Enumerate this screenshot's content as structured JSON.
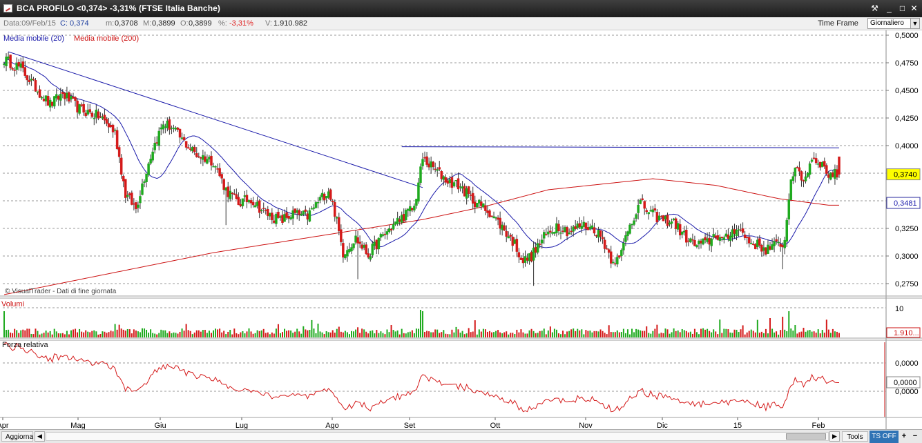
{
  "window": {
    "title": "BCA PROFILO <0,374> -3,31% (FTSE Italia Banche)"
  },
  "infobar": {
    "date": "Data:09/Feb/15",
    "close": "C: 0,374",
    "min_label": "m:",
    "min": "0,3708",
    "max_label": "M:",
    "max": "0,3899",
    "open_label": "O:",
    "open": "0,3899",
    "pct_label": "%:",
    "pct": "-3,31%",
    "vol_label": "V:",
    "vol": "1.910.982",
    "timeframe_label": "Time Frame",
    "timeframe_value": "Giornaliero"
  },
  "price_panel": {
    "legend_ma20": "Media mobile (20)",
    "legend_ma200": "Media mobile (200)",
    "watermark": "© VisualTrader - Dati di fine giornata",
    "y_labels": [
      "0,5000",
      "0,4750",
      "0,4500",
      "0,4250",
      "0,4000",
      "0,3750",
      "0,3500",
      "0,3250",
      "0,3000",
      "0,2750"
    ],
    "last_price_tag": "0,3740",
    "ma_tag": "0,3481"
  },
  "volume_panel": {
    "label": "Volumi",
    "y_label": "10",
    "last_tag": "1.910..."
  },
  "rs_panel": {
    "label": "Forza relativa",
    "y_labels": [
      "0,0000",
      "0,0000"
    ],
    "last_tag": "0,0000"
  },
  "x_labels": [
    "Apr",
    "Mag",
    "Giu",
    "Lug",
    "Ago",
    "Set",
    "Ott",
    "Nov",
    "Dic",
    "15",
    "Feb"
  ],
  "bottombar": {
    "refresh": "Aggiorna",
    "tools": "Tools",
    "tsoff": "TS OFF",
    "plus": "+",
    "minus": "−"
  },
  "colors": {
    "up": "#1faa1f",
    "down": "#d41a1a",
    "ma20": "#1a1aaa",
    "ma200": "#cc1111",
    "trendline": "#1a1aaa",
    "last_price_bg": "#ffff00"
  },
  "chart_data": {
    "type": "candlestick",
    "title": "BCA PROFILO",
    "ylim": [
      0.265,
      0.505
    ],
    "keypoints": [
      [
        0,
        0.478
      ],
      [
        8,
        0.47
      ],
      [
        14,
        0.455
      ],
      [
        22,
        0.437
      ],
      [
        28,
        0.447
      ],
      [
        36,
        0.433
      ],
      [
        46,
        0.426
      ],
      [
        53,
        0.412
      ],
      [
        58,
        0.356
      ],
      [
        63,
        0.343
      ],
      [
        66,
        0.365
      ],
      [
        71,
        0.397
      ],
      [
        76,
        0.42
      ],
      [
        80,
        0.417
      ],
      [
        85,
        0.405
      ],
      [
        92,
        0.392
      ],
      [
        100,
        0.386
      ],
      [
        106,
        0.36
      ],
      [
        112,
        0.348
      ],
      [
        118,
        0.352
      ],
      [
        124,
        0.34
      ],
      [
        132,
        0.332
      ],
      [
        138,
        0.338
      ],
      [
        145,
        0.336
      ],
      [
        150,
        0.349
      ],
      [
        155,
        0.36
      ],
      [
        158,
        0.34
      ],
      [
        162,
        0.303
      ],
      [
        168,
        0.316
      ],
      [
        174,
        0.301
      ],
      [
        180,
        0.316
      ],
      [
        186,
        0.328
      ],
      [
        192,
        0.338
      ],
      [
        196,
        0.344
      ],
      [
        200,
        0.388
      ],
      [
        206,
        0.378
      ],
      [
        212,
        0.368
      ],
      [
        218,
        0.363
      ],
      [
        223,
        0.352
      ],
      [
        232,
        0.34
      ],
      [
        238,
        0.326
      ],
      [
        244,
        0.311
      ],
      [
        248,
        0.295
      ],
      [
        252,
        0.3
      ],
      [
        258,
        0.317
      ],
      [
        264,
        0.328
      ],
      [
        270,
        0.322
      ],
      [
        276,
        0.328
      ],
      [
        282,
        0.325
      ],
      [
        286,
        0.315
      ],
      [
        290,
        0.298
      ],
      [
        294,
        0.296
      ],
      [
        298,
        0.325
      ],
      [
        304,
        0.348
      ],
      [
        308,
        0.34
      ],
      [
        314,
        0.333
      ],
      [
        320,
        0.331
      ],
      [
        324,
        0.32
      ],
      [
        330,
        0.31
      ],
      [
        336,
        0.312
      ],
      [
        340,
        0.32
      ],
      [
        344,
        0.313
      ],
      [
        350,
        0.327
      ],
      [
        356,
        0.313
      ],
      [
        360,
        0.31
      ],
      [
        364,
        0.306
      ],
      [
        368,
        0.309
      ],
      [
        371,
        0.311
      ],
      [
        373,
        0.313
      ],
      [
        376,
        0.373
      ],
      [
        380,
        0.377
      ],
      [
        382,
        0.367
      ],
      [
        386,
        0.389
      ],
      [
        390,
        0.385
      ],
      [
        394,
        0.374
      ]
    ],
    "ma200_keypoints": [
      [
        0,
        0.265
      ],
      [
        100,
        0.303
      ],
      [
        200,
        0.333
      ],
      [
        230,
        0.345
      ],
      [
        260,
        0.36
      ],
      [
        310,
        0.37
      ],
      [
        340,
        0.364
      ],
      [
        370,
        0.352
      ],
      [
        394,
        0.346
      ]
    ],
    "trendlines": [
      {
        "from": [
          2,
          0.485
        ],
        "to": [
          200,
          0.362
        ]
      },
      {
        "from": [
          190,
          0.399
        ],
        "to": [
          399,
          0.398
        ]
      }
    ]
  }
}
